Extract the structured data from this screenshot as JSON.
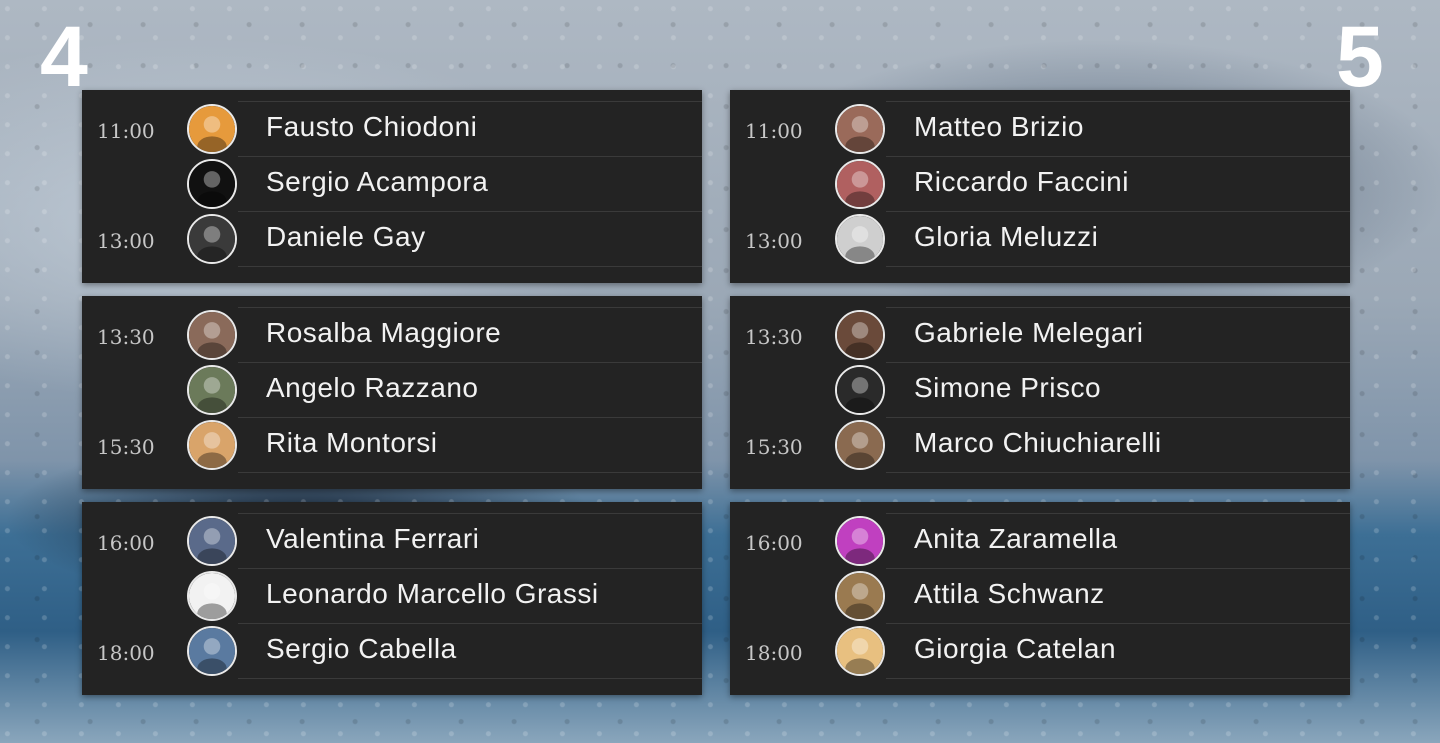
{
  "days": [
    {
      "day": "4",
      "blocks": [
        {
          "slots": [
            {
              "time": "11:00",
              "name": "Fausto Chiodoni",
              "avatar_color": "#e69a3c"
            },
            {
              "time": "",
              "name": "Sergio Acampora",
              "avatar_color": "#111111"
            },
            {
              "time": "13:00",
              "name": "Daniele Gay",
              "avatar_color": "#3a3a3a"
            }
          ]
        },
        {
          "slots": [
            {
              "time": "13:30",
              "name": "Rosalba Maggiore",
              "avatar_color": "#8a6a5a"
            },
            {
              "time": "",
              "name": "Angelo Razzano",
              "avatar_color": "#6b7a5a"
            },
            {
              "time": "15:30",
              "name": "Rita Montorsi",
              "avatar_color": "#d9a46a"
            }
          ]
        },
        {
          "slots": [
            {
              "time": "16:00",
              "name": "Valentina Ferrari",
              "avatar_color": "#5a6a8a"
            },
            {
              "time": "",
              "name": "Leonardo Marcello Grassi",
              "avatar_color": "#f2f2f2"
            },
            {
              "time": "18:00",
              "name": "Sergio Cabella",
              "avatar_color": "#5a7aa0"
            }
          ]
        }
      ]
    },
    {
      "day": "5",
      "blocks": [
        {
          "slots": [
            {
              "time": "11:00",
              "name": "Matteo Brizio",
              "avatar_color": "#9a6a5a"
            },
            {
              "time": "",
              "name": "Riccardo Faccini",
              "avatar_color": "#b06060"
            },
            {
              "time": "13:00",
              "name": "Gloria Meluzzi",
              "avatar_color": "#cfcfcf"
            }
          ]
        },
        {
          "slots": [
            {
              "time": "13:30",
              "name": "Gabriele Melegari",
              "avatar_color": "#6a4a3a"
            },
            {
              "time": "",
              "name": "Simone Prisco",
              "avatar_color": "#2a2a2a"
            },
            {
              "time": "15:30",
              "name": "Marco Chiuchiarelli",
              "avatar_color": "#8a6a50"
            }
          ]
        },
        {
          "slots": [
            {
              "time": "16:00",
              "name": "Anita Zaramella",
              "avatar_color": "#c040c0"
            },
            {
              "time": "",
              "name": "Attila Schwanz",
              "avatar_color": "#9a7a50"
            },
            {
              "time": "18:00",
              "name": "Giorgia Catelan",
              "avatar_color": "#e8c080"
            }
          ]
        }
      ]
    }
  ]
}
